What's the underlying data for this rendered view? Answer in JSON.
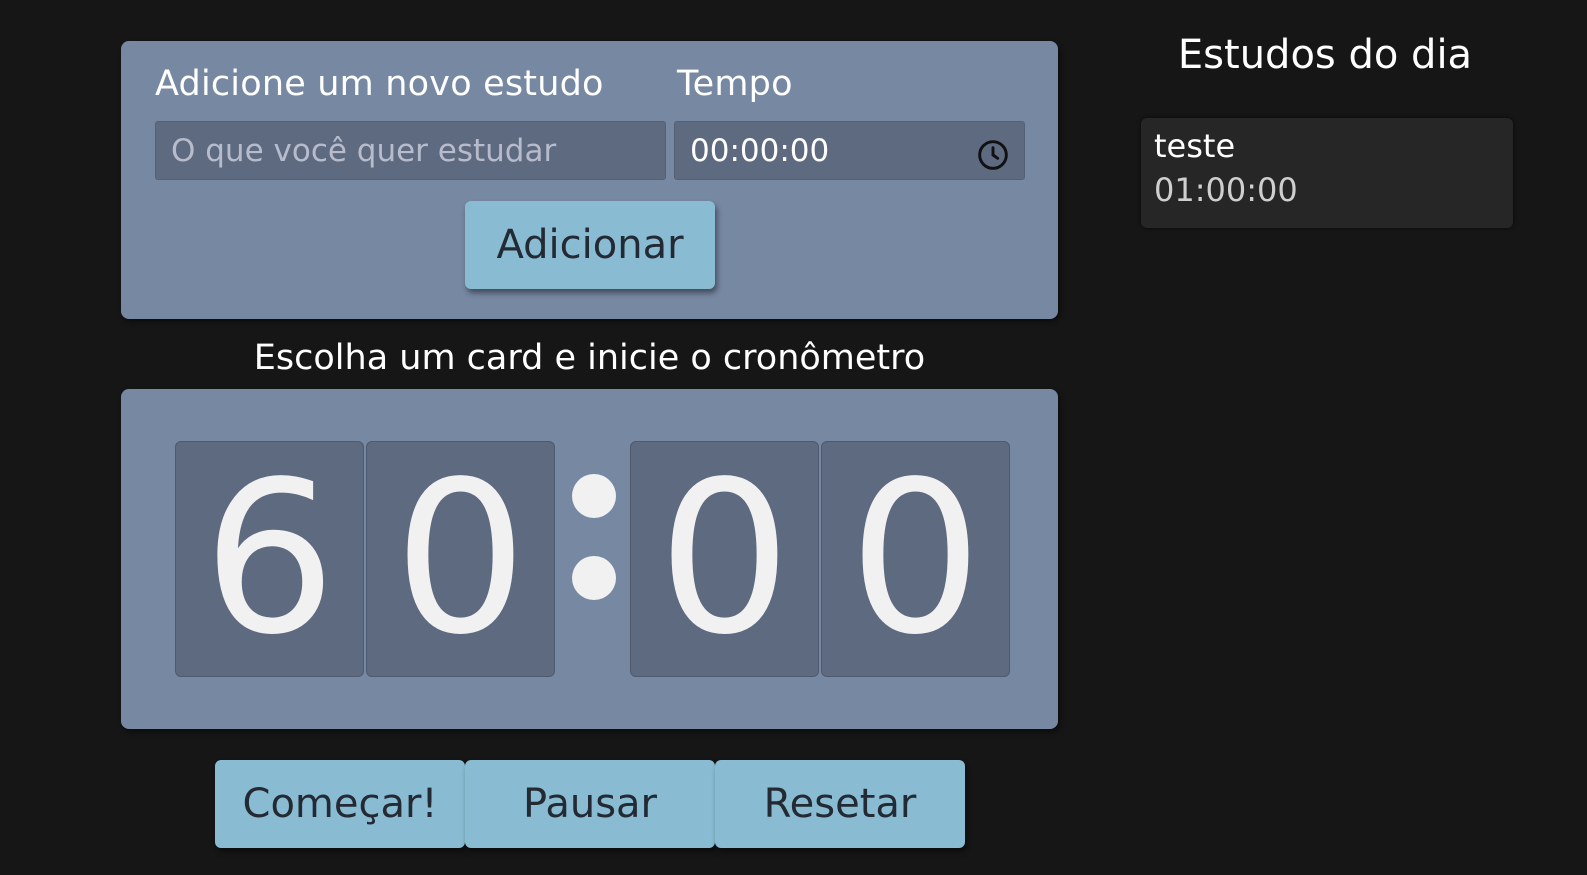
{
  "form": {
    "study_label": "Adicione um novo estudo",
    "time_label": "Tempo",
    "study_placeholder": "O que você quer estudar",
    "time_value": "00:00:00",
    "time_icon": "clock-icon",
    "add_button": "Adicionar"
  },
  "timer": {
    "hint": "Escolha um card e inicie o cronômetro",
    "digits": [
      "6",
      "0",
      "0",
      "0"
    ]
  },
  "controls": {
    "start": "Começar!",
    "pause": "Pausar",
    "reset": "Resetar"
  },
  "side": {
    "title": "Estudos do dia",
    "items": [
      {
        "name": "teste",
        "time": "01:00:00"
      }
    ]
  },
  "colors": {
    "background": "#161616",
    "panel": "#7788a3",
    "input": "#5e6a80",
    "button": "#89bcd2",
    "card": "#262626"
  }
}
